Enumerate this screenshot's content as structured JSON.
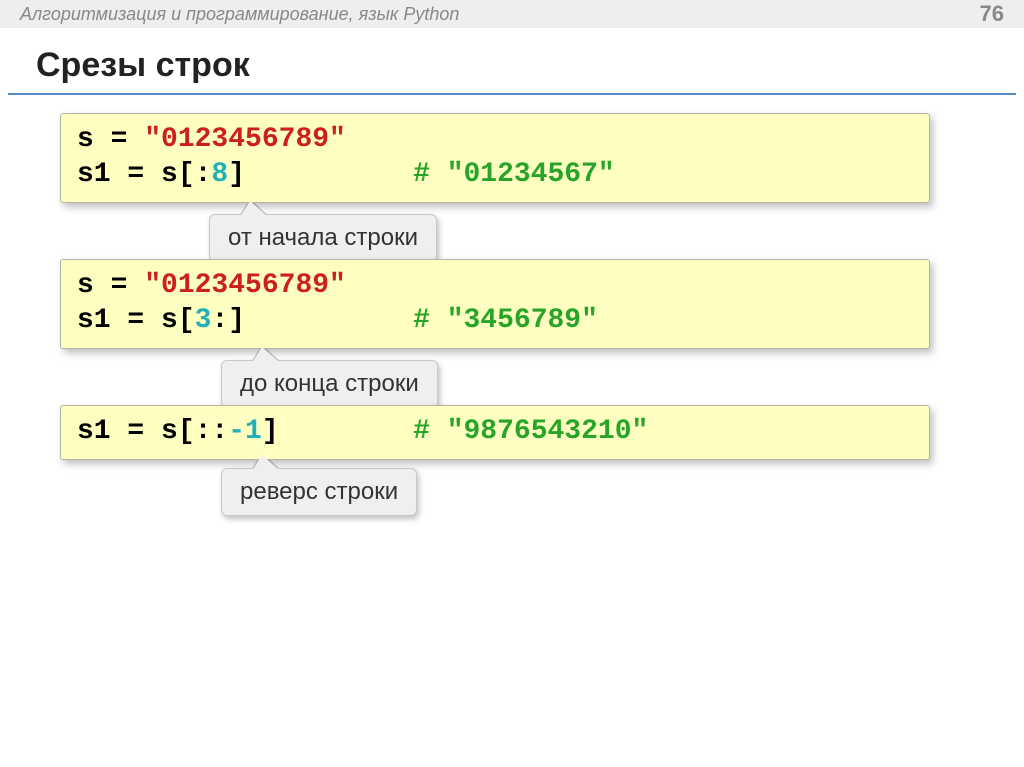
{
  "header": {
    "breadcrumb": "Алгоритмизация и программирование, язык Python",
    "page_number": "76"
  },
  "title": "Срезы строк",
  "block1": {
    "line1_a": "s = ",
    "line1_b": "\"0123456789\"",
    "line2_a": "s1 = s[:",
    "line2_b": "8",
    "line2_c": "]",
    "comment_hash": "# ",
    "comment_text": "\"01234567\"",
    "callout": "от начала строки"
  },
  "block2": {
    "line1_a": "s = ",
    "line1_b": "\"0123456789\"",
    "line2_a": "s1 = s[",
    "line2_b": "3",
    "line2_c": ":]",
    "comment_hash": "# ",
    "comment_text": "\"3456789\"",
    "callout": "до конца строки"
  },
  "block3": {
    "line_a": "s1 = s[::",
    "line_b": "-1",
    "line_c": "]",
    "comment_hash": "# ",
    "comment_text": "\"9876543210\"",
    "callout": "реверс строки"
  }
}
